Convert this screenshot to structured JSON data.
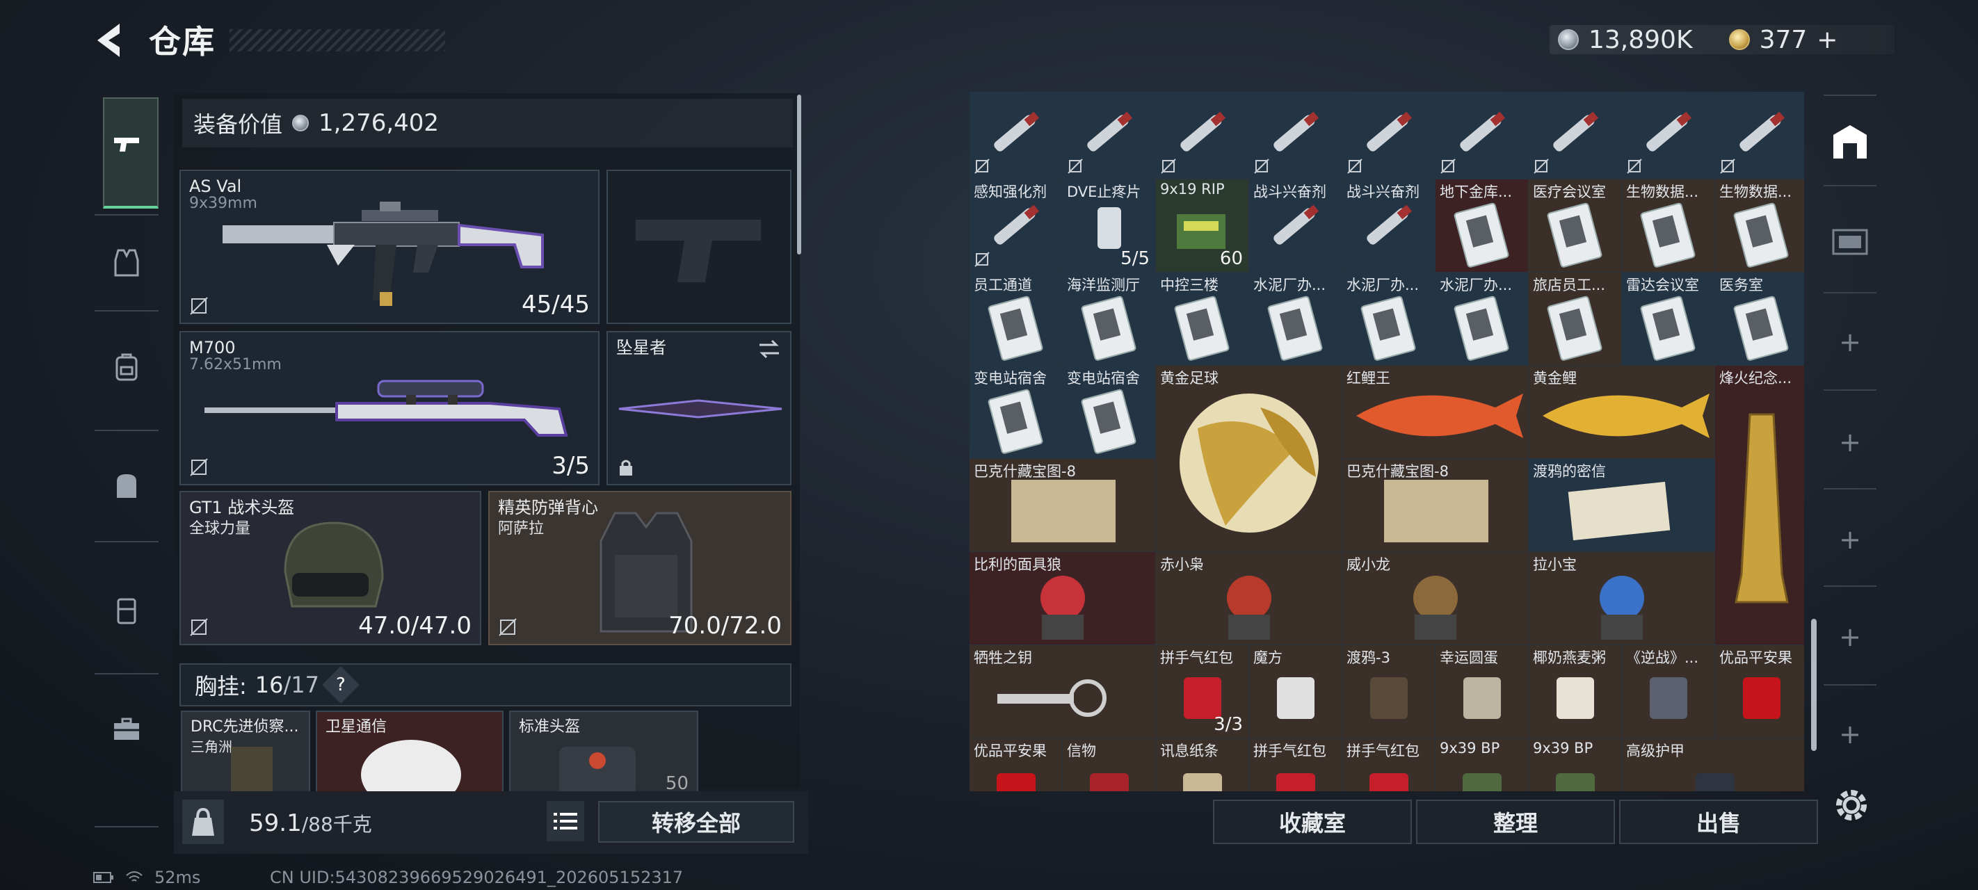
{
  "header": {
    "title": "仓库",
    "currency_silver": "13,890K",
    "currency_gold": "377",
    "plus": "+"
  },
  "sidebar": {
    "items": [
      "weapon-icon",
      "vest-icon",
      "helmet-icon",
      "backpack-icon",
      "case-icon",
      "toolbox-icon"
    ]
  },
  "loadout": {
    "equip_value_label": "装备价值",
    "equip_value": "1,276,402",
    "primary": {
      "name": "AS Val",
      "caliber": "9x39mm",
      "count": "45/45"
    },
    "secondary": {
      "name": "M700",
      "caliber": "7.62x51mm",
      "count": "3/5"
    },
    "melee": {
      "name": "坠星者"
    },
    "helmet": {
      "name": "GT1 战术头盔",
      "sub": "全球力量",
      "count": "47.0/47.0"
    },
    "armor": {
      "name": "精英防弹背心",
      "sub": "阿萨拉",
      "count": "70.0/72.0"
    },
    "chest": {
      "label": "胸挂:",
      "value": "16",
      "max": "/17",
      "help": "?"
    },
    "chest_items": [
      {
        "name": "DRC先进侦察...",
        "sub": "三角洲"
      },
      {
        "name": "卫星通信",
        "sub": ""
      },
      {
        "name": "标准头盔",
        "sub": "",
        "count": "50"
      }
    ],
    "weight": {
      "value": "59.1",
      "max": "/88千克"
    },
    "transfer_label": "转移全部"
  },
  "storage": {
    "rows": [
      [
        {
          "lbl": "",
          "c": "blue"
        },
        {
          "lbl": "",
          "c": "blue"
        },
        {
          "lbl": "",
          "c": "blue"
        },
        {
          "lbl": "",
          "c": "blue"
        },
        {
          "lbl": "",
          "c": "blue"
        },
        {
          "lbl": "",
          "c": "blue"
        },
        {
          "lbl": "",
          "c": "blue"
        },
        {
          "lbl": "",
          "c": "blue"
        },
        {
          "lbl": "",
          "c": "blue"
        }
      ],
      [
        {
          "lbl": "感知强化剂",
          "c": "blue"
        },
        {
          "lbl": "DVE止疼片",
          "c": "blue",
          "qty": "5/5"
        },
        {
          "lbl": "9x19 RIP",
          "c": "green",
          "qty": "60"
        },
        {
          "lbl": "战斗兴奋剂",
          "c": "blue"
        },
        {
          "lbl": "战斗兴奋剂",
          "c": "blue"
        },
        {
          "lbl": "地下金库...",
          "c": "red"
        },
        {
          "lbl": "医疗会议室",
          "c": "brown"
        },
        {
          "lbl": "生物数据...",
          "c": "brown"
        },
        {
          "lbl": "生物数据...",
          "c": "brown"
        }
      ],
      [
        {
          "lbl": "员工通道",
          "c": "blue"
        },
        {
          "lbl": "海洋监测厅",
          "c": "blue"
        },
        {
          "lbl": "中控三楼",
          "c": "blue"
        },
        {
          "lbl": "水泥厂办...",
          "c": "blue"
        },
        {
          "lbl": "水泥厂办...",
          "c": "blue"
        },
        {
          "lbl": "水泥厂办...",
          "c": "blue"
        },
        {
          "lbl": "旅店员工...",
          "c": "brown"
        },
        {
          "lbl": "雷达会议室",
          "c": "blue"
        },
        {
          "lbl": "医务室",
          "c": "blue"
        }
      ]
    ],
    "big_items": [
      {
        "lbl": "变电站宿舍"
      },
      {
        "lbl": "变电站宿舍"
      },
      {
        "lbl": "黄金足球"
      },
      {
        "lbl": "红鲤王"
      },
      {
        "lbl": "黄金鲤"
      },
      {
        "lbl": "烽火纪念..."
      },
      {
        "lbl": "巴克什藏宝图-8"
      },
      {
        "lbl": "巴克什藏宝图-8"
      },
      {
        "lbl": "渡鸦的密信"
      },
      {
        "lbl": "比利的面具狼"
      },
      {
        "lbl": "赤小枭"
      },
      {
        "lbl": "威小龙"
      },
      {
        "lbl": "拉小宝"
      }
    ],
    "row7": [
      {
        "lbl": "牺牲之钥"
      },
      {
        "lbl": "拼手气红包",
        "qty": "3/3"
      },
      {
        "lbl": "魔方"
      },
      {
        "lbl": "渡鸦-3"
      },
      {
        "lbl": "幸运圆蛋"
      },
      {
        "lbl": "椰奶燕麦粥"
      },
      {
        "lbl": "《逆战》..."
      },
      {
        "lbl": "优品平安果"
      }
    ],
    "row8": [
      {
        "lbl": "优品平安果"
      },
      {
        "lbl": "信物"
      },
      {
        "lbl": "讯息纸条"
      },
      {
        "lbl": "拼手气红包"
      },
      {
        "lbl": "拼手气红包"
      },
      {
        "lbl": "9x39 BP"
      },
      {
        "lbl": "9x39 BP"
      },
      {
        "lbl": "高级护甲"
      }
    ],
    "buttons": [
      "收藏室",
      "整理",
      "出售"
    ]
  },
  "status": {
    "ping": "52ms",
    "uid": "CN UID:54308239669529026491_202605152317"
  },
  "colors": {
    "accent": "#67d39a",
    "panel": "#1e2731"
  }
}
